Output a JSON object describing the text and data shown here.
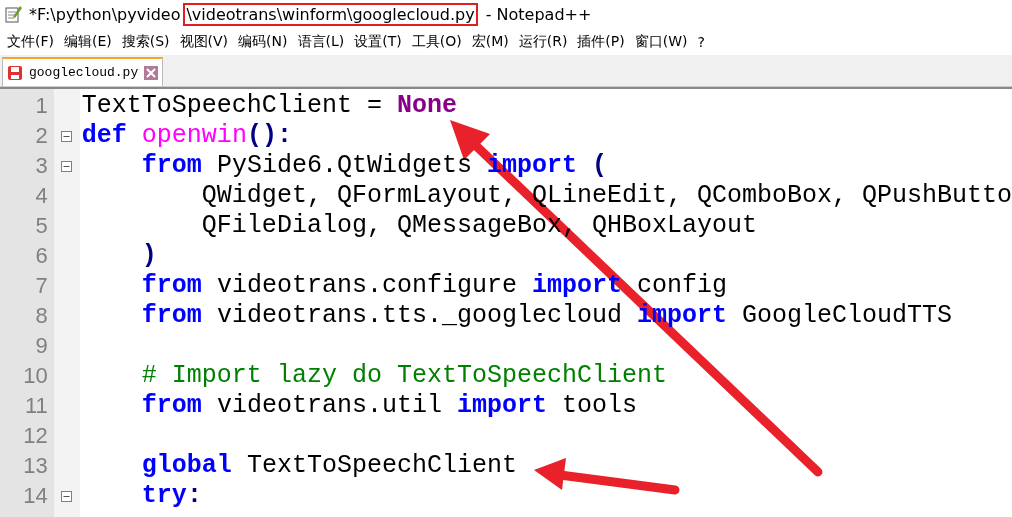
{
  "window": {
    "title_parts": [
      {
        "text": "*F:\\python\\pyvideo",
        "highlighted": false
      },
      {
        "text": "\\videotrans\\winform\\googlecloud.py",
        "highlighted": true
      },
      {
        "text": " - Notepad++",
        "highlighted": false
      }
    ]
  },
  "menu": [
    "文件(F)",
    "编辑(E)",
    "搜索(S)",
    "视图(V)",
    "编码(N)",
    "语言(L)",
    "设置(T)",
    "工具(O)",
    "宏(M)",
    "运行(R)",
    "插件(P)",
    "窗口(W)",
    "?"
  ],
  "tabs": [
    {
      "label": "googlecloud.py",
      "selected": true,
      "modified": true
    }
  ],
  "editor": {
    "lines": [
      {
        "number": "1",
        "fold": false,
        "tokens": [
          {
            "kind": "plain",
            "text": "TextToSpeechClient = "
          },
          {
            "kind": "constant",
            "text": "None"
          }
        ]
      },
      {
        "number": "2",
        "fold": true,
        "tokens": [
          {
            "kind": "keyword",
            "text": "def"
          },
          {
            "kind": "function",
            "text": " openwin"
          },
          {
            "kind": "punct",
            "text": "():"
          }
        ]
      },
      {
        "number": "3",
        "fold": true,
        "tokens": [
          {
            "kind": "keyword",
            "text": "    from"
          },
          {
            "kind": "plain",
            "text": " PySide6.QtWidgets "
          },
          {
            "kind": "keyword",
            "text": "import"
          },
          {
            "kind": "punct",
            "text": " ("
          }
        ]
      },
      {
        "number": "4",
        "fold": false,
        "tokens": [
          {
            "kind": "plain",
            "text": "        QWidget, QFormLayout, QLineEdit, QComboBox, QPushButto"
          }
        ]
      },
      {
        "number": "5",
        "fold": false,
        "tokens": [
          {
            "kind": "plain",
            "text": "        QFileDialog, QMessageBox, QHBoxLayout"
          }
        ]
      },
      {
        "number": "6",
        "fold": false,
        "tokens": [
          {
            "kind": "punct",
            "text": "    )"
          }
        ]
      },
      {
        "number": "7",
        "fold": false,
        "tokens": [
          {
            "kind": "keyword",
            "text": "    from"
          },
          {
            "kind": "plain",
            "text": " videotrans.configure "
          },
          {
            "kind": "keyword",
            "text": "import"
          },
          {
            "kind": "plain",
            "text": " config"
          }
        ]
      },
      {
        "number": "8",
        "fold": false,
        "tokens": [
          {
            "kind": "keyword",
            "text": "    from"
          },
          {
            "kind": "plain",
            "text": " videotrans.tts._googlecloud "
          },
          {
            "kind": "keyword",
            "text": "import"
          },
          {
            "kind": "plain",
            "text": " GoogleCloudTTS"
          }
        ]
      },
      {
        "number": "9",
        "fold": false
      },
      {
        "number": "10",
        "fold": false,
        "tokens": [
          {
            "kind": "comment",
            "text": "    # Import lazy do TextToSpeechClient"
          }
        ]
      },
      {
        "number": "11",
        "fold": false,
        "tokens": [
          {
            "kind": "keyword",
            "text": "    from"
          },
          {
            "kind": "plain",
            "text": " videotrans.util "
          },
          {
            "kind": "keyword",
            "text": "import"
          },
          {
            "kind": "plain",
            "text": " tools"
          }
        ]
      },
      {
        "number": "12",
        "fold": false
      },
      {
        "number": "13",
        "fold": false,
        "tokens": [
          {
            "kind": "keyword",
            "text": "    global"
          },
          {
            "kind": "plain",
            "text": " TextToSpeechClient"
          }
        ]
      },
      {
        "number": "14",
        "fold": true,
        "tokens": [
          {
            "kind": "keyword",
            "text": "    try"
          },
          {
            "kind": "punct",
            "text": ":"
          }
        ]
      }
    ]
  }
}
